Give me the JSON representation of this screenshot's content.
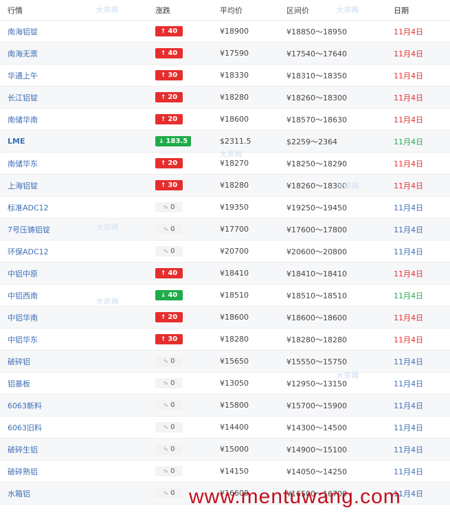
{
  "headers": {
    "name": "行情",
    "change": "涨跌",
    "avg": "平均价",
    "range": "区间价",
    "date": "日期"
  },
  "rows": [
    {
      "name": "南海铝锭",
      "dir": "up",
      "change": "40",
      "avg": "¥18900",
      "range": "¥18850～18950",
      "date": "11月4日",
      "date_color": "red"
    },
    {
      "name": "南海无票",
      "dir": "up",
      "change": "40",
      "avg": "¥17590",
      "range": "¥17540～17640",
      "date": "11月4日",
      "date_color": "red"
    },
    {
      "name": "华通上午",
      "dir": "up",
      "change": "30",
      "avg": "¥18330",
      "range": "¥18310～18350",
      "date": "11月4日",
      "date_color": "red"
    },
    {
      "name": "长江铝锭",
      "dir": "up",
      "change": "20",
      "avg": "¥18280",
      "range": "¥18260～18300",
      "date": "11月4日",
      "date_color": "red"
    },
    {
      "name": "南储华南",
      "dir": "up",
      "change": "20",
      "avg": "¥18600",
      "range": "¥18570～18630",
      "date": "11月4日",
      "date_color": "red"
    },
    {
      "name": "LME",
      "dir": "down",
      "change": "183.5",
      "avg": "$2311.5",
      "range": "$2259～2364",
      "date": "11月4日",
      "date_color": "green"
    },
    {
      "name": "南储华东",
      "dir": "up",
      "change": "20",
      "avg": "¥18270",
      "range": "¥18250～18290",
      "date": "11月4日",
      "date_color": "red"
    },
    {
      "name": "上海铝锭",
      "dir": "up",
      "change": "30",
      "avg": "¥18280",
      "range": "¥18260～18300",
      "date": "11月4日",
      "date_color": "red"
    },
    {
      "name": "标准ADC12",
      "dir": "flat",
      "change": "0",
      "avg": "¥19350",
      "range": "¥19250～19450",
      "date": "11月4日",
      "date_color": "blue"
    },
    {
      "name": "7号压铸铝锭",
      "dir": "flat",
      "change": "0",
      "avg": "¥17700",
      "range": "¥17600～17800",
      "date": "11月4日",
      "date_color": "blue"
    },
    {
      "name": "环保ADC12",
      "dir": "flat",
      "change": "0",
      "avg": "¥20700",
      "range": "¥20600～20800",
      "date": "11月4日",
      "date_color": "blue"
    },
    {
      "name": "中铝中原",
      "dir": "up",
      "change": "40",
      "avg": "¥18410",
      "range": "¥18410～18410",
      "date": "11月4日",
      "date_color": "red"
    },
    {
      "name": "中铝西南",
      "dir": "down",
      "change": "40",
      "avg": "¥18510",
      "range": "¥18510～18510",
      "date": "11月4日",
      "date_color": "green"
    },
    {
      "name": "中铝华南",
      "dir": "up",
      "change": "20",
      "avg": "¥18600",
      "range": "¥18600～18600",
      "date": "11月4日",
      "date_color": "red"
    },
    {
      "name": "中铝华东",
      "dir": "up",
      "change": "30",
      "avg": "¥18280",
      "range": "¥18280～18280",
      "date": "11月4日",
      "date_color": "red"
    },
    {
      "name": "破碎铝",
      "dir": "flat",
      "change": "0",
      "avg": "¥15650",
      "range": "¥15550～15750",
      "date": "11月4日",
      "date_color": "blue"
    },
    {
      "name": "铝基板",
      "dir": "flat",
      "change": "0",
      "avg": "¥13050",
      "range": "¥12950～13150",
      "date": "11月4日",
      "date_color": "blue"
    },
    {
      "name": "6063新料",
      "dir": "flat",
      "change": "0",
      "avg": "¥15800",
      "range": "¥15700～15900",
      "date": "11月4日",
      "date_color": "blue"
    },
    {
      "name": "6063旧料",
      "dir": "flat",
      "change": "0",
      "avg": "¥14400",
      "range": "¥14300～14500",
      "date": "11月4日",
      "date_color": "blue"
    },
    {
      "name": "破碎生铝",
      "dir": "flat",
      "change": "0",
      "avg": "¥15000",
      "range": "¥14900～15100",
      "date": "11月4日",
      "date_color": "blue"
    },
    {
      "name": "破碎熟铝",
      "dir": "flat",
      "change": "0",
      "avg": "¥14150",
      "range": "¥14050～14250",
      "date": "11月4日",
      "date_color": "blue"
    },
    {
      "name": "水箱铝",
      "dir": "flat",
      "change": "0",
      "avg": "¥16600",
      "range": "¥16500～16700",
      "date": "11月4日",
      "date_color": "blue"
    }
  ],
  "watermark": "www.mentuwang.com",
  "logo_watermark": "大宗网",
  "colors": {
    "up": "#e62e2e",
    "down": "#1fab4a",
    "flat_bg": "#f3f3f3",
    "link": "#3d6fb6"
  },
  "icons": {
    "up": "arrow-up-icon",
    "down": "arrow-down-icon",
    "flat": "flat-wave-icon"
  }
}
